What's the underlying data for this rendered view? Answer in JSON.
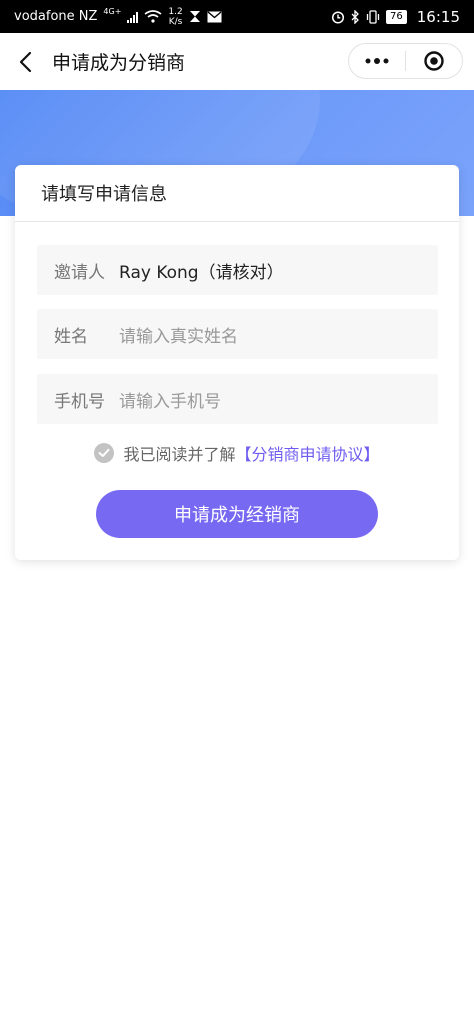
{
  "status_bar": {
    "carrier": "vodafone NZ",
    "network": "4G+",
    "speed_value": "1.2",
    "speed_unit": "K/s",
    "battery": "76",
    "time": "16:15"
  },
  "navbar": {
    "title": "申请成为分销商"
  },
  "card": {
    "heading": "请填写申请信息",
    "fields": [
      {
        "label": "邀请人",
        "value": "Ray Kong（请核对）"
      },
      {
        "label": "姓名",
        "placeholder": "请输入真实姓名"
      },
      {
        "label": "手机号",
        "placeholder": "请输入手机号"
      }
    ],
    "agreement_text": "我已阅读并了解",
    "agreement_link": "【分销商申请协议】",
    "submit_label": "申请成为经销商"
  },
  "colors": {
    "banner": "#5b8ef7",
    "accent": "#7869f3",
    "link": "#6e5cf1"
  }
}
